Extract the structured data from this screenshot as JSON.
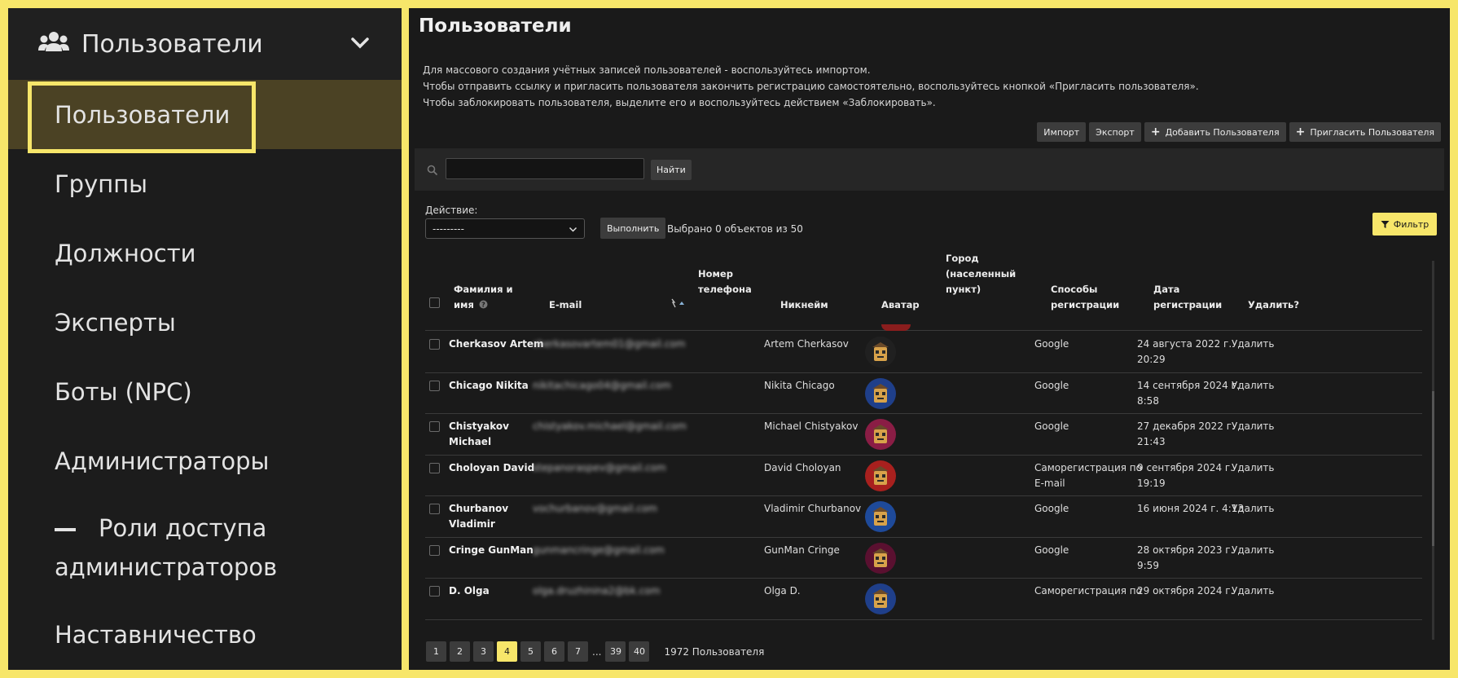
{
  "sidebar": {
    "header": {
      "title": "Пользователи",
      "icon": "users-icon"
    },
    "items": [
      {
        "label": "Пользователи"
      },
      {
        "label": "Группы"
      },
      {
        "label": "Должности"
      },
      {
        "label": "Эксперты"
      },
      {
        "label": "Боты (NPC)"
      },
      {
        "label": "Администраторы"
      },
      {
        "label_line1": "Роли доступа",
        "label_line2": "администраторов"
      },
      {
        "label": "Наставничество"
      }
    ]
  },
  "main": {
    "title": "Пользователи",
    "description": [
      "Для массового создания учётных записей пользователей - воспользуйтесь импортом.",
      "Чтобы отправить ссылку и пригласить пользователя закончить регистрацию самостоятельно, воспользуйтесь кнопкой «Пригласить пользователя».",
      "Чтобы заблокировать пользователя, выделите его и воспользуйтесь действием «Заблокировать»."
    ],
    "toolbar": {
      "import": "Импорт",
      "export": "Экспорт",
      "add_user": "Добавить Пользователя",
      "invite_user": "Пригласить Пользователя"
    },
    "search": {
      "value": "",
      "button": "Найти"
    },
    "action": {
      "label": "Действие:",
      "selected": "---------",
      "run": "Выполнить",
      "count_text": "Выбрано 0 объектов из 50"
    },
    "filter_label": "Фильтр",
    "table": {
      "headers": {
        "name_l1": "Фамилия и",
        "name_l2": "имя",
        "email": "E-mail",
        "phone_l1": "Номер",
        "phone_l2": "телефона",
        "nickname": "Никнейм",
        "avatar": "Аватар",
        "city_l1": "Город",
        "city_l2": "(населенный",
        "city_l3": "пункт)",
        "reg_l1": "Способы",
        "reg_l2": "регистрации",
        "date_l1": "Дата",
        "date_l2": "регистрации",
        "delete": "Удалить?"
      },
      "rows": [
        {
          "name_l1": "Cherkasov Artem",
          "name_l2": "",
          "email": "cherkasovartem01@gmail.com",
          "nickname": "Artem Cherkasov",
          "reg_l1": "Google",
          "reg_l2": "",
          "date_l1": "24 августа 2022 г.",
          "date_l2": "20:29",
          "delete": "Удалить",
          "avatar_bg": "#202020",
          "avatar_icon": "hat-avatar-icon"
        },
        {
          "name_l1": "Chicago Nikita",
          "name_l2": "",
          "email": "nikitachicago04@gmail.com",
          "nickname": "Nikita Chicago",
          "reg_l1": "Google",
          "reg_l2": "",
          "date_l1": "14 сентября 2024 г.",
          "date_l2": "8:58",
          "delete": "Удалить",
          "avatar_bg": "#1f3f8a",
          "avatar_icon": "box-avatar-icon"
        },
        {
          "name_l1": "Chistyakov",
          "name_l2": "Michael",
          "email": "chistyakov.michael@gmail.com",
          "nickname": "Michael Chistyakov",
          "reg_l1": "Google",
          "reg_l2": "",
          "date_l1": "27 декабря 2022 г.",
          "date_l2": "21:43",
          "delete": "Удалить",
          "avatar_bg": "#8a1d45",
          "avatar_icon": "box-avatar-icon"
        },
        {
          "name_l1": "Choloyan David",
          "name_l2": "",
          "email": "stepanoraspev@gmail.com",
          "nickname": "David Choloyan",
          "reg_l1": "Саморегистрация по",
          "reg_l2": "E-mail",
          "date_l1": "9 сентября 2024 г.",
          "date_l2": "19:19",
          "delete": "Удалить",
          "avatar_bg": "#a8201e",
          "avatar_icon": "box-avatar-icon"
        },
        {
          "name_l1": "Churbanov",
          "name_l2": "Vladimir",
          "email": "vochurbanov@gmail.com",
          "nickname": "Vladimir Churbanov",
          "reg_l1": "Google",
          "reg_l2": "",
          "date_l1": "16 июня 2024 г. 4:13",
          "date_l2": "",
          "delete": "Удалить",
          "avatar_bg": "#1e4a9a",
          "avatar_icon": "box-avatar-icon"
        },
        {
          "name_l1": "Cringe GunMan",
          "name_l2": "",
          "email": "gunmancringe@gmail.com",
          "nickname": "GunMan Cringe",
          "reg_l1": "Google",
          "reg_l2": "",
          "date_l1": "28 октября 2023 г.",
          "date_l2": "9:59",
          "delete": "Удалить",
          "avatar_bg": "#5a1030",
          "avatar_icon": "box-avatar-icon"
        },
        {
          "name_l1": "D. Olga",
          "name_l2": "",
          "email": "olga.druzhinina2@bk.com",
          "nickname": "Olga D.",
          "reg_l1": "Саморегистрация по",
          "reg_l2": "",
          "date_l1": "29 октября 2024 г.",
          "date_l2": "",
          "delete": "Удалить",
          "avatar_bg": "#1f3f8a",
          "avatar_icon": "box-avatar-icon"
        }
      ]
    },
    "pagination": {
      "pages": [
        "1",
        "2",
        "3",
        "4",
        "5",
        "6",
        "7"
      ],
      "active": "4",
      "ellipsis": "...",
      "tail": [
        "39",
        "40"
      ],
      "total": "1972 Пользователя"
    }
  },
  "colors": {
    "accent": "#f7e66a",
    "panel": "#1c1c1c",
    "active_bg": "#4b4224"
  }
}
